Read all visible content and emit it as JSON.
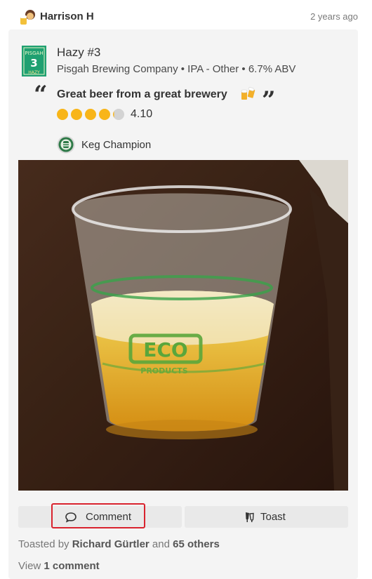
{
  "checkin": {
    "user_name": "Harrison H",
    "time_ago": "2 years ago"
  },
  "beer": {
    "name": "Hazy #3",
    "meta": "Pisgah Brewing Company • IPA - Other • 6.7% ABV",
    "label_text_top": "PISGAH",
    "label_text_number": "3",
    "label_text_bottom": "HAZY"
  },
  "review": {
    "quote_open": "“",
    "quote_text": "Great beer from a great brewery",
    "quote_close": "”",
    "rating_value": "4.10",
    "rating": 4.1,
    "rating_max": 5
  },
  "badge": {
    "name": "Keg Champion"
  },
  "photo": {
    "cup_text": "ECO",
    "cup_subtext": "PRODUCTS"
  },
  "actions": {
    "comment_label": "Comment",
    "toast_label": "Toast"
  },
  "toasts": {
    "prefix": "Toasted by",
    "first_user": "Richard Gürtler",
    "joiner": "and",
    "others": "65 others"
  },
  "comments": {
    "prefix": "View",
    "count_label": "1 comment"
  },
  "colors": {
    "rating_filled": "#f8b518",
    "rating_empty": "#d3d3d3",
    "highlight": "#d9232e"
  }
}
